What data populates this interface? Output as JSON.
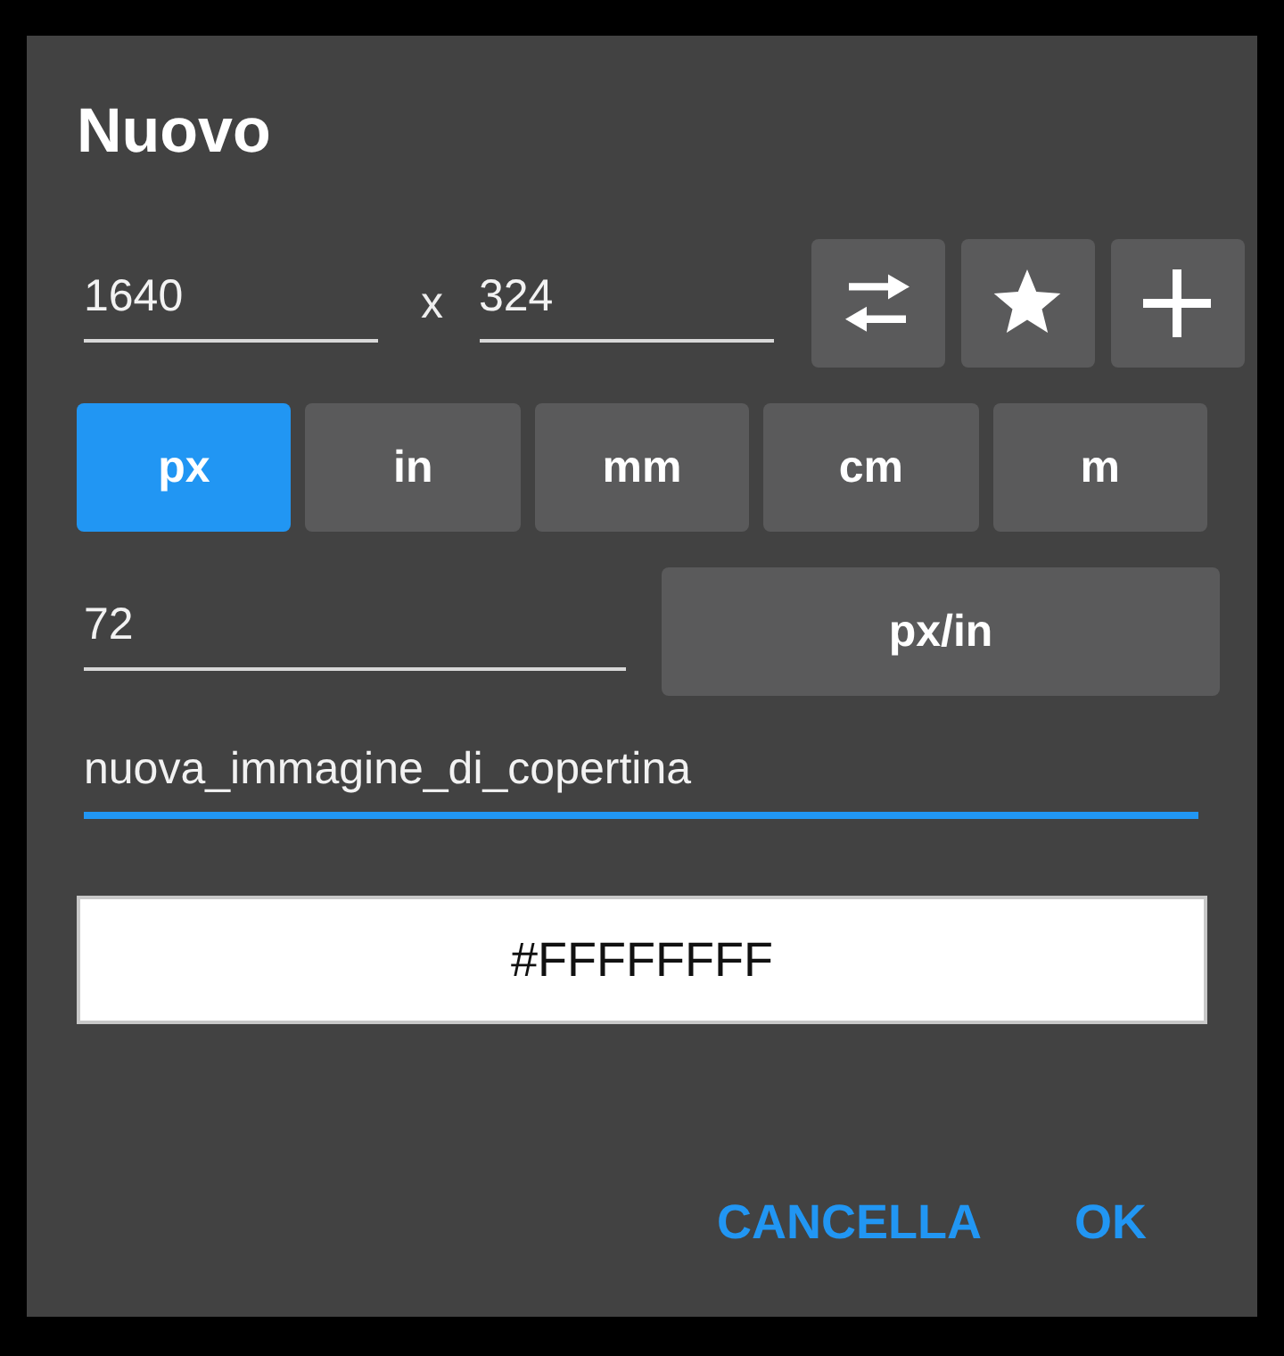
{
  "dialog": {
    "title": "Nuovo",
    "size": {
      "width": {
        "value": "1640",
        "focused": false
      },
      "separator": "x",
      "height": {
        "value": "324",
        "focused": false
      }
    },
    "units": [
      {
        "label": "px",
        "selected": true
      },
      {
        "label": "in",
        "selected": false
      },
      {
        "label": "mm",
        "selected": false
      },
      {
        "label": "cm",
        "selected": false
      },
      {
        "label": "m",
        "selected": false
      }
    ],
    "resolution": {
      "value": "72",
      "focused": false,
      "unit": "px/in"
    },
    "name": {
      "value": "nuova_immagine_di_copertina",
      "focused": true
    },
    "background_color": {
      "value": "#FFFFFFFF",
      "color": "#ffffff"
    },
    "buttons": [
      "CANCELLA",
      "OK"
    ]
  }
}
